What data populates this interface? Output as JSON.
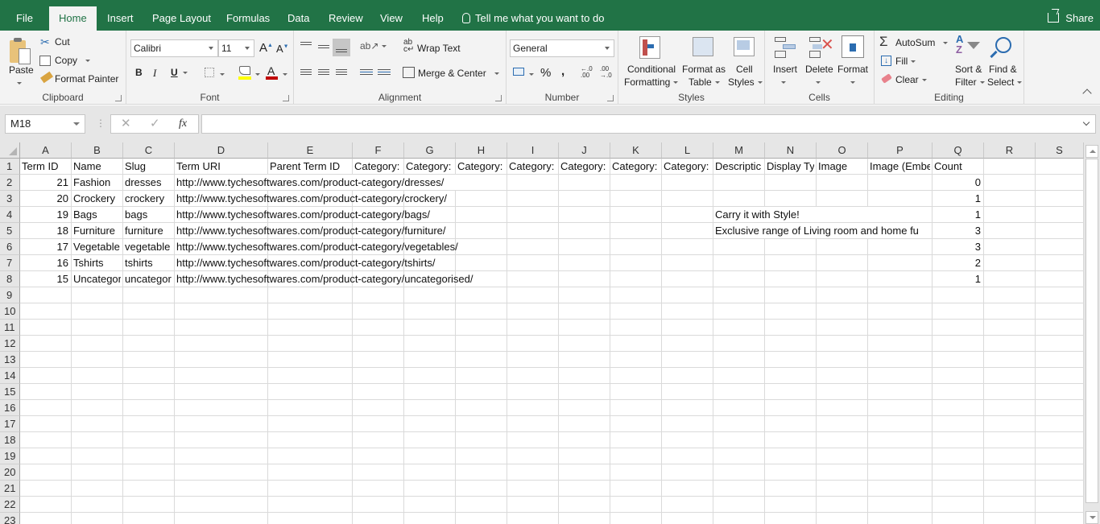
{
  "tabs": [
    {
      "label": "File",
      "active": false
    },
    {
      "label": "Home",
      "active": true
    },
    {
      "label": "Insert",
      "active": false
    },
    {
      "label": "Page Layout",
      "active": false
    },
    {
      "label": "Formulas",
      "active": false
    },
    {
      "label": "Data",
      "active": false
    },
    {
      "label": "Review",
      "active": false
    },
    {
      "label": "View",
      "active": false
    },
    {
      "label": "Help",
      "active": false
    }
  ],
  "tell_me": "Tell me what you want to do",
  "share_label": "Share",
  "theme": {
    "accent": "#217346",
    "ribbon_bg": "#f3f3f3",
    "grid_line": "#dadada"
  },
  "ribbon": {
    "clipboard": {
      "label": "Clipboard",
      "paste": "Paste",
      "cut": "Cut",
      "copy": "Copy",
      "format_painter": "Format Painter"
    },
    "font": {
      "label": "Font",
      "font_name": "Calibri",
      "font_size": "11",
      "bold": "B",
      "italic": "I",
      "underline": "U",
      "fill_color": "#ffff00",
      "font_color": "#c00000"
    },
    "alignment": {
      "label": "Alignment",
      "wrap_text": "Wrap Text",
      "merge_center": "Merge & Center"
    },
    "number": {
      "label": "Number",
      "format": "General",
      "percent": "%",
      "comma": ","
    },
    "styles": {
      "label": "Styles",
      "conditional_1": "Conditional",
      "conditional_2": "Formatting",
      "format_table_1": "Format as",
      "format_table_2": "Table",
      "cell_styles_1": "Cell",
      "cell_styles_2": "Styles"
    },
    "cells": {
      "label": "Cells",
      "insert": "Insert",
      "delete": "Delete",
      "format": "Format"
    },
    "editing": {
      "label": "Editing",
      "autosum": "AutoSum",
      "fill": "Fill",
      "clear": "Clear",
      "sort_1": "Sort &",
      "sort_2": "Filter",
      "find_1": "Find &",
      "find_2": "Select"
    }
  },
  "formula_bar": {
    "name_box": "M18",
    "cancel": "✕",
    "enter": "✓",
    "fx": "fx",
    "formula": ""
  },
  "columns": [
    "A",
    "B",
    "C",
    "D",
    "E",
    "F",
    "G",
    "H",
    "I",
    "J",
    "K",
    "L",
    "M",
    "N",
    "O",
    "P",
    "Q",
    "R",
    "S"
  ],
  "row_numbers": [
    "1",
    "2",
    "3",
    "4",
    "5",
    "6",
    "7",
    "8",
    "9",
    "10",
    "11",
    "12",
    "13",
    "14",
    "15",
    "16",
    "17",
    "18",
    "19",
    "20",
    "21",
    "22",
    "23"
  ],
  "sheet": {
    "header": [
      "Term ID",
      "Name",
      "Slug",
      "Term URI",
      "Parent Term ID",
      "Category:",
      "Category:",
      "Category:",
      "Category:",
      "Category:",
      "Category:",
      "Category:",
      "Descriptic",
      "Display Ty",
      "Image",
      "Image (Embe",
      "Count"
    ],
    "rows": [
      {
        "id": "21",
        "name": "Fashion",
        "slug": "dresses",
        "uri": "http://www.tychesoftwares.com/product-category/dresses/",
        "description": "",
        "count": "0"
      },
      {
        "id": "20",
        "name": "Crockery",
        "slug": "crockery",
        "uri": "http://www.tychesoftwares.com/product-category/crockery/",
        "description": "",
        "count": "1"
      },
      {
        "id": "19",
        "name": "Bags",
        "slug": "bags",
        "uri": "http://www.tychesoftwares.com/product-category/bags/",
        "description": "Carry it with Style!",
        "count": "1"
      },
      {
        "id": "18",
        "name": "Furniture",
        "slug": "furniture",
        "uri": "http://www.tychesoftwares.com/product-category/furniture/",
        "description": "Exclusive range of Living room and home fu",
        "count": "3"
      },
      {
        "id": "17",
        "name": "Vegetable",
        "slug": "vegetable",
        "uri": "http://www.tychesoftwares.com/product-category/vegetables/",
        "description": "",
        "count": "3"
      },
      {
        "id": "16",
        "name": "Tshirts",
        "slug": "tshirts",
        "uri": "http://www.tychesoftwares.com/product-category/tshirts/",
        "description": "",
        "count": "2"
      },
      {
        "id": "15",
        "name": "Uncategor",
        "slug": "uncategor",
        "uri": "http://www.tychesoftwares.com/product-category/uncategorised/",
        "description": "",
        "count": "1"
      }
    ]
  }
}
